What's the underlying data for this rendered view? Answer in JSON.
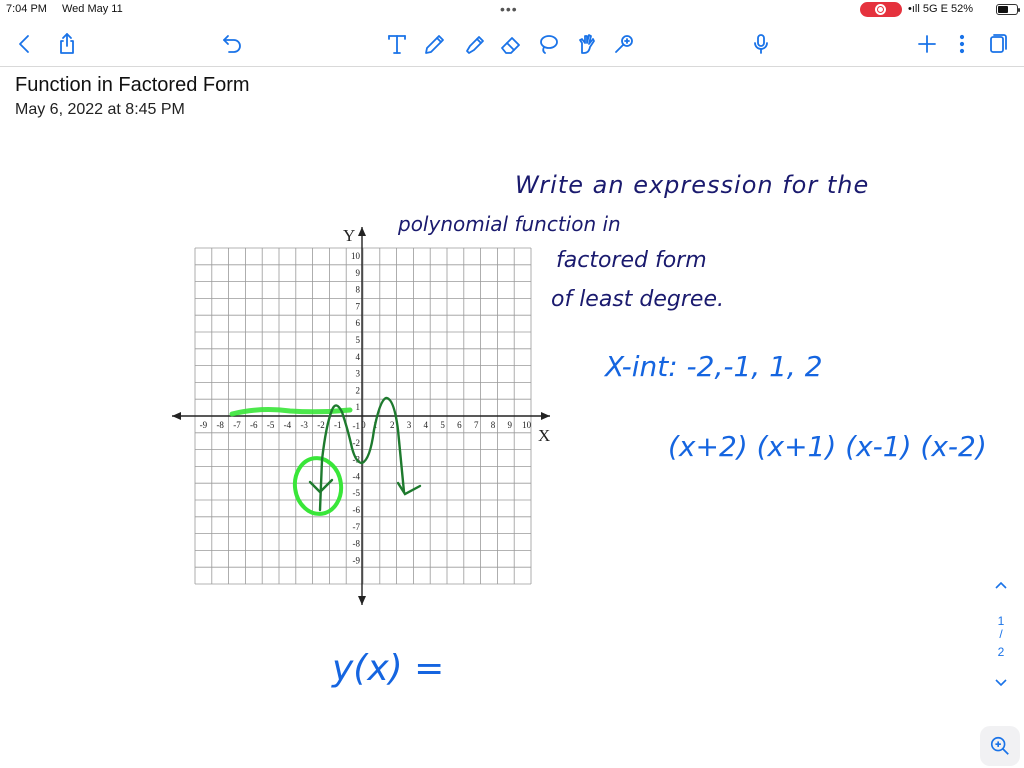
{
  "status_bar": {
    "time": "7:04 PM",
    "date": "Wed May 11",
    "signal": "5G E",
    "battery": "52%"
  },
  "toolbar": {
    "left_icons": [
      "back-chevron-icon",
      "share-icon",
      "undo-icon"
    ],
    "tools": [
      "text-tool-icon",
      "pen-tool-icon",
      "highlighter-icon",
      "eraser-icon",
      "lasso-icon",
      "shapes-icon",
      "laser-pointer-icon"
    ],
    "right_icons": [
      "microphone-icon",
      "add-icon",
      "more-icon",
      "pages-icon"
    ],
    "accent_color": "#1a73e8"
  },
  "note": {
    "title": "Function in Factored Form",
    "date": "May 6, 2022 at 8:45 PM"
  },
  "handwriting": {
    "line1": "Write an expression for the",
    "line2": "polynomial function in",
    "line3": "factored form",
    "line4": "of least degree.",
    "xint": "X-int: -2,-1, 1, 2",
    "factored": "(x+2) (x+1) (x-1) (x-2)",
    "answer": "y(x) =",
    "ink_colors": {
      "dark": "#1a1a6e",
      "blue": "#1565e0",
      "green_pen": "#1e7a2e",
      "highlighter": "#39e639"
    }
  },
  "graph": {
    "y_axis_label": "Y",
    "x_axis_label": "X",
    "x_ticks_neg": [
      "-9",
      "-8",
      "-7",
      "-6",
      "-5",
      "-4",
      "-3",
      "-2",
      "-1"
    ],
    "x_ticks_pos": [
      "1",
      "2",
      "3",
      "4",
      "5",
      "6",
      "7",
      "8",
      "9",
      "10"
    ],
    "origin": "0",
    "y_ticks_pos": [
      "1",
      "2",
      "3",
      "4",
      "5",
      "6",
      "7",
      "8",
      "9",
      "10"
    ],
    "y_ticks_neg": [
      "-1",
      "-2",
      "-3",
      "-4",
      "-5",
      "-6",
      "-7",
      "-8",
      "-9"
    ]
  },
  "page_nav": {
    "current": "1",
    "separator": "/",
    "total": "2"
  }
}
